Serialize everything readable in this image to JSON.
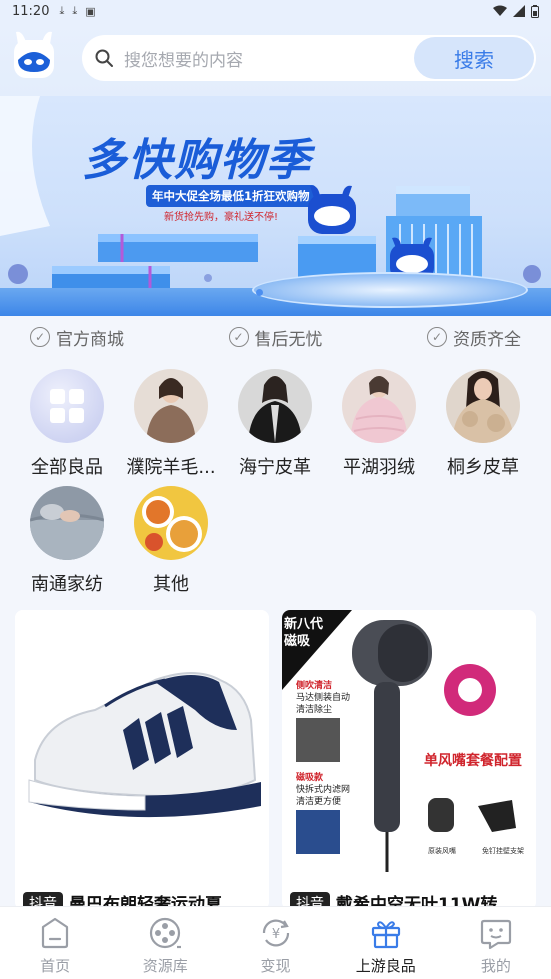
{
  "status_bar": {
    "time": "11:20",
    "left_icons": [
      "download-icon",
      "download-icon",
      "a-icon"
    ],
    "right_icons": [
      "wifi-icon",
      "signal-icon",
      "battery-icon"
    ]
  },
  "search": {
    "placeholder": "搜您想要的内容",
    "button_label": "搜索"
  },
  "banner": {
    "title": "多快购物季",
    "subtitle": "年中大促全场最低1折狂欢购物",
    "tagline": "新货抢先购，豪礼送不停!",
    "active_slide_index": 0
  },
  "assurances": [
    "官方商城",
    "售后无忧",
    "资质齐全"
  ],
  "categories": [
    {
      "label": "全部良品",
      "icon": "grid-icon"
    },
    {
      "label": "濮院羊毛...",
      "icon": "sweater-photo"
    },
    {
      "label": "海宁皮革",
      "icon": "leather-jacket-photo"
    },
    {
      "label": "平湖羽绒",
      "icon": "down-jacket-photo"
    },
    {
      "label": "桐乡皮草",
      "icon": "fur-coat-photo"
    },
    {
      "label": "南通家纺",
      "icon": "bedding-photo"
    },
    {
      "label": "其他",
      "icon": "food-photo"
    }
  ],
  "products": [
    {
      "platform": "抖音",
      "title": "曼巴布朗轻奢运动夏",
      "image": "sneaker-image"
    },
    {
      "platform": "抖音",
      "title": "戴希中空无叶11W转",
      "image": "hair-dryer-image",
      "image_text": {
        "corner": [
          "新八代",
          "磁吸"
        ],
        "feature1_title": "侧吹清洁",
        "feature1_desc": [
          "马达侧装自动",
          "清洁除尘"
        ],
        "feature2_title": "磁吸款",
        "feature2_desc": [
          "快拆式内滤网",
          "清洁更方便"
        ],
        "config": "单风嘴套餐配置",
        "acc1": "原装风嘴",
        "acc2": "免钉挂壁支架"
      }
    }
  ],
  "bottom_nav": {
    "items": [
      {
        "label": "首页",
        "icon": "home-icon",
        "active": false
      },
      {
        "label": "资源库",
        "icon": "film-reel-icon",
        "active": false
      },
      {
        "label": "变现",
        "icon": "yen-cycle-icon",
        "active": false
      },
      {
        "label": "上游良品",
        "icon": "gift-icon",
        "active": true
      },
      {
        "label": "我的",
        "icon": "profile-face-icon",
        "active": false
      }
    ]
  },
  "colors": {
    "accent": "#3a7ce8",
    "active_nav": "#3a7ce8",
    "inactive_nav": "#9a9ea6"
  }
}
